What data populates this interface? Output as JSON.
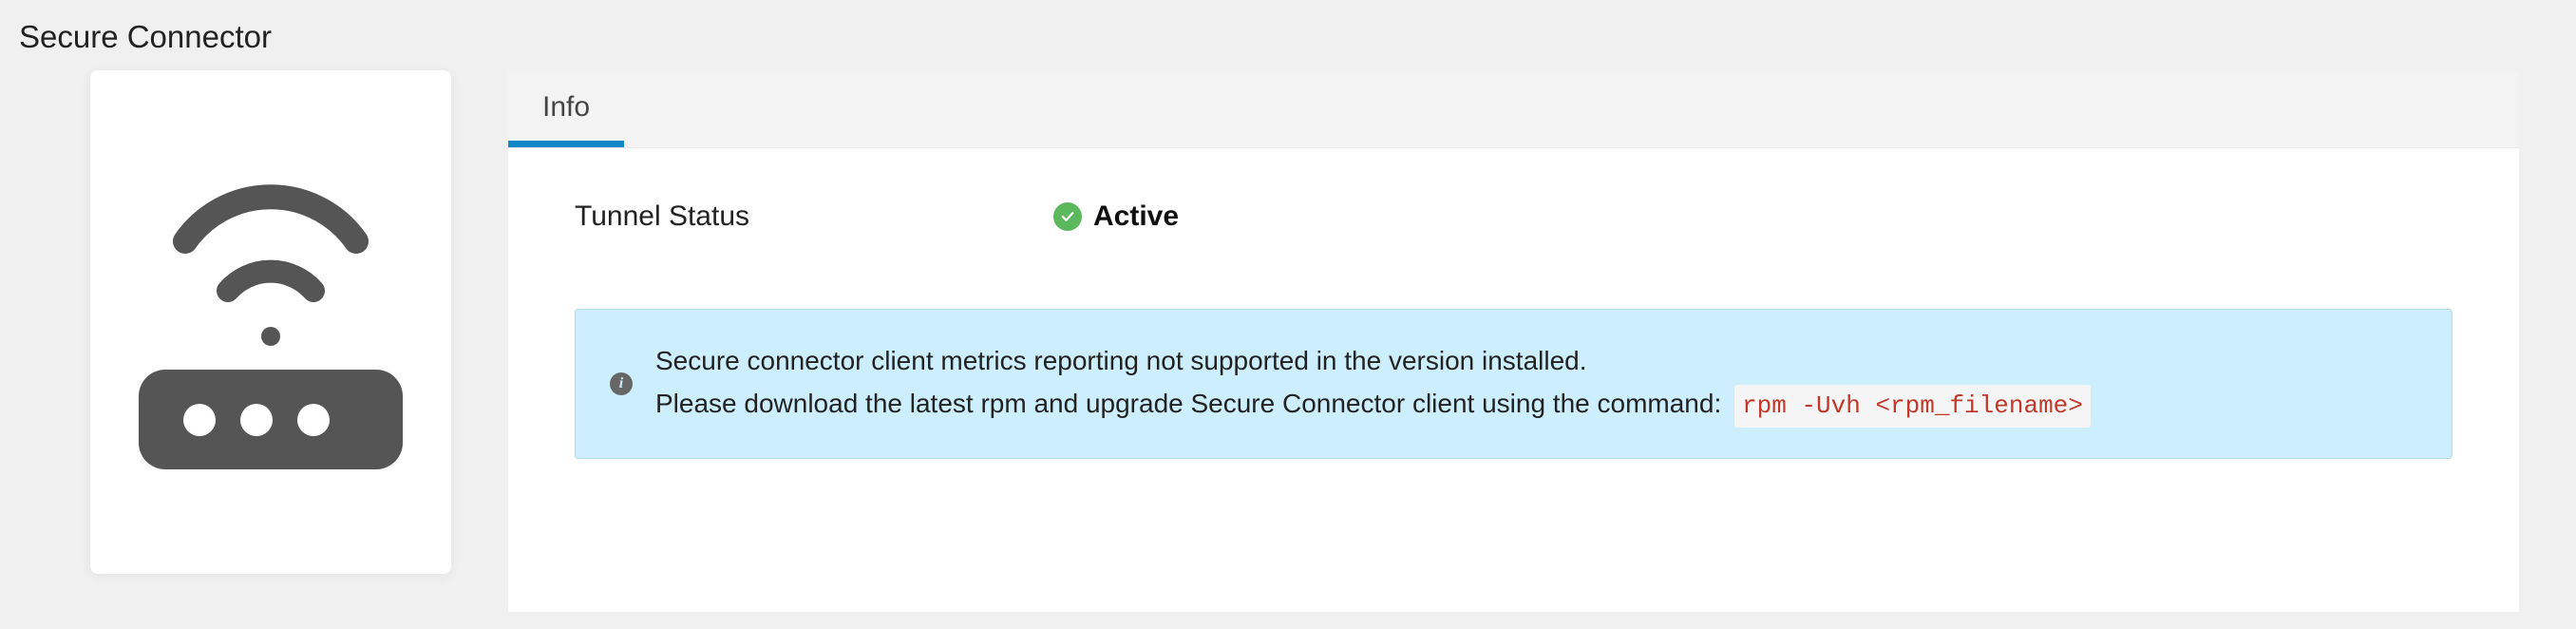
{
  "page": {
    "title": "Secure Connector"
  },
  "tabs": {
    "info": "Info"
  },
  "status": {
    "label": "Tunnel Status",
    "value": "Active"
  },
  "banner": {
    "line1": "Secure connector client metrics reporting not supported in the version installed.",
    "line2_prefix": "Please download the latest rpm and upgrade Secure Connector client using the command:",
    "command": "rpm -Uvh <rpm_filename>"
  },
  "icons": {
    "router": "router-icon",
    "check": "check-icon",
    "info": "info-icon"
  }
}
